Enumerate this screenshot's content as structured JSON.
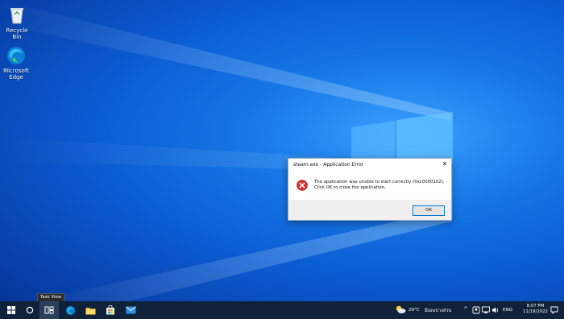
{
  "desktop": {
    "icons": [
      {
        "label": "Recycle Bin"
      },
      {
        "label": "Microsoft Edge"
      }
    ]
  },
  "dialog": {
    "title": "steam.exe - Application Error",
    "message_line1": "The application was unable to start correctly (0xc0000102).",
    "message_line2": "Click OK to close the application.",
    "ok_label": "OK",
    "close_glyph": "✕"
  },
  "tooltip": {
    "text": "Task View"
  },
  "taskbar": {
    "weather": "29°C",
    "weather_desc": "มีเมฆบางส่วน",
    "language": "ENG",
    "time": "8:57 PM",
    "date": "11/19/2022",
    "accent": "#0078d7"
  }
}
